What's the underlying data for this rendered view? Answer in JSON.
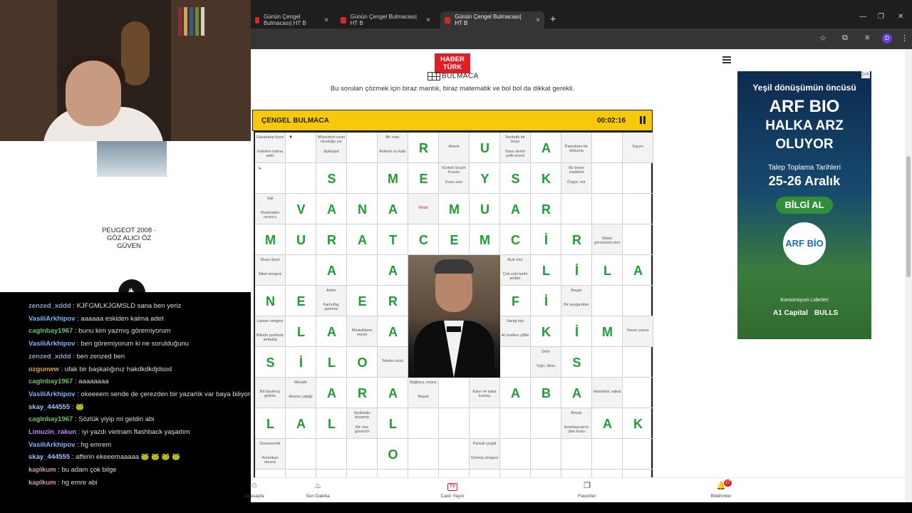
{
  "side_ad": {
    "text": "PEUGEOT 2008 - GÖZ ALICI ÖZ GÜVEN"
  },
  "chat": [
    {
      "user": "zenzed_xddd",
      "color": "#8aa0c8",
      "msg": "KJFGMLKJGMSLD sana ben yeriz"
    },
    {
      "user": "VasiliArkhipov",
      "color": "#7fb3ff",
      "msg": "aaaaaa eskiden kalma adet"
    },
    {
      "user": "caglnbay1967",
      "color": "#6cc26c",
      "msg": "bunu kim yazmış göremiyorum"
    },
    {
      "user": "VasiliArkhipov",
      "color": "#7fb3ff",
      "msg": "ben göremiyorum ki ne sorulduğunu"
    },
    {
      "user": "zenzed_xddd",
      "color": "#8aa0c8",
      "msg": "ben zenzed ben"
    },
    {
      "user": "ozgunww",
      "color": "#e0a040",
      "msg": "ufak bir başkalığınız hakdkdkdjdsod"
    },
    {
      "user": "caglnbay1967",
      "color": "#6cc26c",
      "msg": "aaaaaaaa"
    },
    {
      "user": "VasiliArkhipov",
      "color": "#7fb3ff",
      "msg": "okeeeem sende de çerezden bir yazarlık var baya biliyorsun"
    },
    {
      "user": "skay_444555",
      "color": "#a0c0ff",
      "msg": "🐸"
    },
    {
      "user": "caglnbay1967",
      "color": "#6cc26c",
      "msg": "Sözlük yiyip mi geldin abi"
    },
    {
      "user": "Limuzin_rakun",
      "color": "#c080ff",
      "msg": "iyi yazdı vietnam flashback yaşadım"
    },
    {
      "user": "VasiliArkhipov",
      "color": "#7fb3ff",
      "msg": "hg emrem"
    },
    {
      "user": "skay_444555",
      "color": "#a0c0ff",
      "msg": "afferin ekeeemaaaaa 🐸 🐸 🐸 🐸"
    },
    {
      "user": "kaplkum",
      "color": "#d0a0a0",
      "msg": "bu adam çok bilge"
    },
    {
      "user": "kaplkum",
      "color": "#d0a0a0",
      "msg": "hg emre abi"
    }
  ],
  "browser": {
    "tabs": [
      {
        "label": "Günün Çengel Bulmacası| HT B",
        "active": false
      },
      {
        "label": "Günün Çengel Bulmacası| HT B",
        "active": false
      },
      {
        "label": "Günün Çengel Bulmacası| HT B",
        "active": true
      }
    ],
    "profile_initial": "D"
  },
  "header": {
    "logo_line1": "HABER",
    "logo_line2": "TÜRK",
    "logo_sub": "BULMACA",
    "subtitle": "Bu soruları çözmek için biraz mantık, biraz matematik ve bol bol da dikkat gerekli."
  },
  "puzzle": {
    "title": "ÇENGEL BULMACA",
    "timer": "00:02:16",
    "grid_cols": 13,
    "grid_rows": 12,
    "cells": [
      {
        "r": 0,
        "c": 0,
        "clue": [
          "Gaziantep ilçesi",
          "",
          "Eskiden kalma adet"
        ]
      },
      {
        "r": 0,
        "c": 1,
        "arrow": "▼"
      },
      {
        "r": 0,
        "c": 2,
        "clue": [
          "Müezzinin ezan okuduğu yer",
          "",
          "Epikopal"
        ]
      },
      {
        "r": 0,
        "c": 4,
        "clue": [
          "Bir nota",
          "",
          "Askerin su kabı"
        ]
      },
      {
        "r": 0,
        "c": 5,
        "letter": "R"
      },
      {
        "r": 0,
        "c": 6,
        "clue": [
          "Ahenk"
        ]
      },
      {
        "r": 0,
        "c": 7,
        "letter": "U"
      },
      {
        "r": 0,
        "c": 8,
        "clue": [
          "Sentetik bir boya",
          "",
          "Yassı demir çelik ürünü"
        ]
      },
      {
        "r": 0,
        "c": 9,
        "letter": "A"
      },
      {
        "r": 0,
        "c": 10,
        "clue": [
          "Pamuktan bir dokuma"
        ]
      },
      {
        "r": 0,
        "c": 12,
        "clue": [
          "Sayım"
        ]
      },
      {
        "r": 1,
        "c": 0,
        "arrow": "↳"
      },
      {
        "r": 1,
        "c": 2,
        "letter": "S"
      },
      {
        "r": 1,
        "c": 4,
        "letter": "M"
      },
      {
        "r": 1,
        "c": 5,
        "letter": "E"
      },
      {
        "r": 1,
        "c": 6,
        "clue": [
          "Kürkeli Seçim Kurulu",
          "",
          "Kuzu sesi"
        ]
      },
      {
        "r": 1,
        "c": 7,
        "letter": "Y"
      },
      {
        "r": 1,
        "c": 8,
        "letter": "S"
      },
      {
        "r": 1,
        "c": 9,
        "letter": "K"
      },
      {
        "r": 1,
        "c": 10,
        "clue": [
          "Bir besin maddesi",
          "",
          "Özgür, hür"
        ]
      },
      {
        "r": 2,
        "c": 0,
        "clue": [
          "Vali",
          "",
          "Resimdeki oyuncu"
        ]
      },
      {
        "r": 2,
        "c": 1,
        "letter": "V"
      },
      {
        "r": 2,
        "c": 2,
        "letter": "A"
      },
      {
        "r": 2,
        "c": 3,
        "letter": "N"
      },
      {
        "r": 2,
        "c": 4,
        "letter": "A"
      },
      {
        "r": 2,
        "c": 5,
        "clue": [
          "İhtilaf"
        ],
        "red": true
      },
      {
        "r": 2,
        "c": 6,
        "letter": "M"
      },
      {
        "r": 2,
        "c": 7,
        "letter": "U"
      },
      {
        "r": 2,
        "c": 8,
        "letter": "A"
      },
      {
        "r": 2,
        "c": 9,
        "letter": "R"
      },
      {
        "r": 3,
        "c": 0,
        "letter": "M"
      },
      {
        "r": 3,
        "c": 1,
        "letter": "U"
      },
      {
        "r": 3,
        "c": 2,
        "letter": "R"
      },
      {
        "r": 3,
        "c": 3,
        "letter": "A"
      },
      {
        "r": 3,
        "c": 4,
        "letter": "T"
      },
      {
        "r": 3,
        "c": 5,
        "letter": "C"
      },
      {
        "r": 3,
        "c": 6,
        "letter": "E"
      },
      {
        "r": 3,
        "c": 7,
        "letter": "M"
      },
      {
        "r": 3,
        "c": 8,
        "letter": "C"
      },
      {
        "r": 3,
        "c": 9,
        "letter": "İ"
      },
      {
        "r": 3,
        "c": 10,
        "letter": "R"
      },
      {
        "r": 3,
        "c": 11,
        "clue": [
          "Metal görünümlü deri"
        ]
      },
      {
        "r": 4,
        "c": 0,
        "clue": [
          "Sivas ilçesi",
          "",
          "Nikel simgesi"
        ]
      },
      {
        "r": 4,
        "c": 2,
        "letter": "A"
      },
      {
        "r": 4,
        "c": 4,
        "letter": "A"
      },
      {
        "r": 4,
        "c": 8,
        "clue": [
          "Açık mor",
          "",
          "Çok eski tarihi anlatır"
        ]
      },
      {
        "r": 4,
        "c": 9,
        "letter": "L"
      },
      {
        "r": 4,
        "c": 10,
        "letter": "İ"
      },
      {
        "r": 4,
        "c": 11,
        "letter": "L"
      },
      {
        "r": 4,
        "c": 12,
        "letter": "A"
      },
      {
        "r": 5,
        "c": 0,
        "letter": "N"
      },
      {
        "r": 5,
        "c": 1,
        "letter": "E"
      },
      {
        "r": 5,
        "c": 2,
        "clue": [
          "Asker",
          "",
          "Kamuflaj, gizleme"
        ]
      },
      {
        "r": 5,
        "c": 3,
        "letter": "E"
      },
      {
        "r": 5,
        "c": 4,
        "letter": "R"
      },
      {
        "r": 5,
        "c": 8,
        "letter": "F"
      },
      {
        "r": 5,
        "c": 9,
        "letter": "İ"
      },
      {
        "r": 5,
        "c": 10,
        "clue": [
          "Beygir",
          "",
          "Bir peygamber"
        ]
      },
      {
        "r": 6,
        "c": 0,
        "clue": [
          "Lantan simgesi",
          "Bilindir şeklinde ambalaj"
        ]
      },
      {
        "r": 6,
        "c": 1,
        "letter": "L"
      },
      {
        "r": 6,
        "c": 2,
        "letter": "A"
      },
      {
        "r": 6,
        "c": 3,
        "clue": [
          "Müstahkem mevki"
        ]
      },
      {
        "r": 6,
        "c": 4,
        "letter": "A"
      },
      {
        "r": 6,
        "c": 8,
        "clue": [
          "Hangi kişi",
          "",
          "At üretilen çiftlik"
        ]
      },
      {
        "r": 6,
        "c": 9,
        "letter": "K"
      },
      {
        "r": 6,
        "c": 10,
        "letter": "İ"
      },
      {
        "r": 6,
        "c": 11,
        "letter": "M"
      },
      {
        "r": 6,
        "c": 12,
        "clue": [
          "Yorum yazısı"
        ]
      },
      {
        "r": 7,
        "c": 0,
        "letter": "S"
      },
      {
        "r": 7,
        "c": 1,
        "letter": "İ"
      },
      {
        "r": 7,
        "c": 2,
        "letter": "L"
      },
      {
        "r": 7,
        "c": 3,
        "letter": "O"
      },
      {
        "r": 7,
        "c": 4,
        "clue": [
          "Telefon sözü"
        ]
      },
      {
        "r": 7,
        "c": 9,
        "clue": [
          "Zehir",
          "",
          "Sığır, öküz"
        ]
      },
      {
        "r": 7,
        "c": 10,
        "letter": "S"
      },
      {
        "r": 8,
        "c": 0,
        "clue": [
          "Bil tutulmuş gizlisiz"
        ]
      },
      {
        "r": 8,
        "c": 1,
        "clue": [
          "Mesafe",
          "",
          "Akarsu yatağı"
        ]
      },
      {
        "r": 8,
        "c": 2,
        "letter": "A"
      },
      {
        "r": 8,
        "c": 3,
        "letter": "R"
      },
      {
        "r": 8,
        "c": 4,
        "letter": "A"
      },
      {
        "r": 8,
        "c": 5,
        "clue": [
          "Bağlaca, esans",
          "",
          "Nispet"
        ]
      },
      {
        "r": 8,
        "c": 7,
        "clue": [
          "Kalın ve kaba kumaş"
        ]
      },
      {
        "r": 8,
        "c": 8,
        "letter": "A"
      },
      {
        "r": 8,
        "c": 9,
        "letter": "B"
      },
      {
        "r": 8,
        "c": 10,
        "letter": "A"
      },
      {
        "r": 8,
        "c": 11,
        "clue": [
          "Hastalıklı, sakat"
        ]
      },
      {
        "r": 9,
        "c": 0,
        "letter": "L"
      },
      {
        "r": 9,
        "c": 1,
        "letter": "A"
      },
      {
        "r": 9,
        "c": 2,
        "letter": "L"
      },
      {
        "r": 9,
        "c": 3,
        "clue": [
          "Ayakkabı boyama",
          "",
          "Bir cins güvercin"
        ]
      },
      {
        "r": 9,
        "c": 4,
        "letter": "L"
      },
      {
        "r": 9,
        "c": 10,
        "clue": [
          "Beyaz",
          "",
          "Azerbaycan'ın ülke kodu"
        ]
      },
      {
        "r": 9,
        "c": 11,
        "letter": "A"
      },
      {
        "r": 9,
        "c": 12,
        "letter": "K"
      },
      {
        "r": 10,
        "c": 0,
        "clue": [
          "Güvenmelik",
          "",
          "Amerikan devesi"
        ]
      },
      {
        "r": 10,
        "c": 4,
        "letter": "O"
      },
      {
        "r": 10,
        "c": 7,
        "clue": [
          "Pamuk çeşidi",
          "",
          "Gümüş simgesi"
        ]
      }
    ]
  },
  "right_ad": {
    "line1": "Yeşil dönüşümün öncüsü",
    "line2": "ARF BIO",
    "line3": "HALKA ARZ",
    "line4": "OLUYOR",
    "line5": "Talep Toplama Tarihleri",
    "line6": "25-26 Aralık",
    "cta": "BİLGİ AL",
    "logo": "ARF BİO",
    "foot": "Konsorsiyum Liderleri",
    "partner1": "A1 Capital",
    "partner2": "BULLS"
  },
  "bottom_nav": [
    {
      "icon": "⌂",
      "label": "Anasayfa"
    },
    {
      "icon": "♨",
      "label": "Son Dakika"
    },
    {
      "icon": "TV",
      "label": "Canlı Yayın"
    },
    {
      "icon": "❐",
      "label": "Favoriler"
    },
    {
      "icon": "🔔",
      "label": "Bildirimler",
      "badge": "27"
    }
  ],
  "colors": {
    "accent": "#f7c90a",
    "brand_red": "#e11d25",
    "letter_green": "#1f9d35"
  }
}
